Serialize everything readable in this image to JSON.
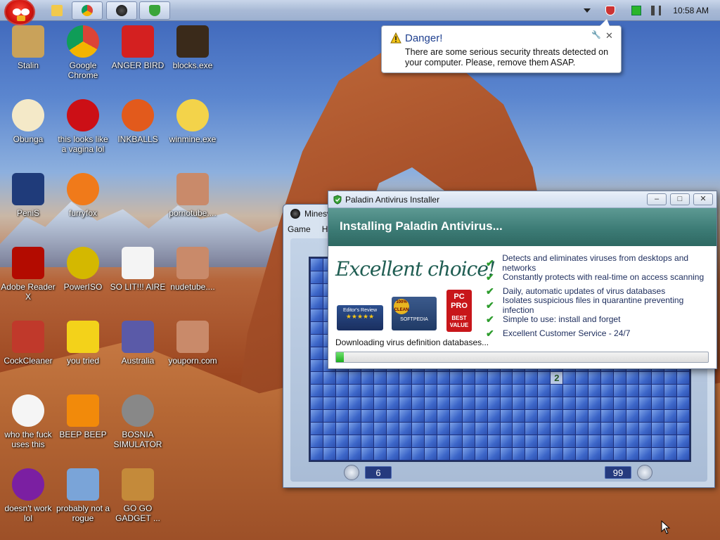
{
  "taskbar": {
    "clock": "10:58 AM",
    "buttons": [
      "folder-icon",
      "chrome-icon",
      "minesweeper-icon",
      "shield-icon"
    ]
  },
  "desktop": {
    "icons": [
      {
        "label": "Stalin",
        "icon": "user-folder-icon"
      },
      {
        "label": "Google Chrome",
        "icon": "chrome-icon"
      },
      {
        "label": "ANGER BIRD",
        "icon": "angry-bird-icon"
      },
      {
        "label": "blocks.exe",
        "icon": "blocks-icon"
      },
      {
        "label": "Obunga",
        "icon": "egg-icon"
      },
      {
        "label": "this looks like a vagina lol",
        "icon": "opera-icon"
      },
      {
        "label": "INKBALLS",
        "icon": "inkball-icon"
      },
      {
        "label": "winmine.exe",
        "icon": "flower-icon"
      },
      {
        "label": "PeniS",
        "icon": "photoshop-icon"
      },
      {
        "label": "furryfox",
        "icon": "firefox-icon"
      },
      {
        "label": "pornotube....",
        "icon": "thumbnail-icon"
      },
      {
        "label": "Adobe Reader X",
        "icon": "adobe-reader-icon"
      },
      {
        "label": "PowerISO",
        "icon": "disc-icon"
      },
      {
        "label": "SO LIT!!! AIRE",
        "icon": "solitaire-icon"
      },
      {
        "label": "nudetube....",
        "icon": "thumbnail-icon"
      },
      {
        "label": "CockCleaner",
        "icon": "ccleaner-icon"
      },
      {
        "label": "you tried",
        "icon": "star-icon"
      },
      {
        "label": "Australia",
        "icon": "chess-icon"
      },
      {
        "label": "youporn.com",
        "icon": "thumbnail-icon"
      },
      {
        "label": "who the fuck uses this",
        "icon": "winamp-icon"
      },
      {
        "label": "BEEP BEEP",
        "icon": "vlc-icon"
      },
      {
        "label": "BOSNIA SIMULATOR",
        "icon": "mine-icon"
      },
      {
        "label": "doesn't work lol",
        "icon": "yahoo-icon"
      },
      {
        "label": "probably not a rogue",
        "icon": "computer-gears-icon"
      },
      {
        "label": "GO GO GADGET ...",
        "icon": "briefcase-icon"
      }
    ]
  },
  "balloon": {
    "title": "Danger!",
    "message": "There are some serious security threats detected on your computer. Please, remove them ASAP."
  },
  "minesweeper": {
    "title": "Minesw",
    "menu": [
      "Game",
      "H"
    ],
    "revealed_number": "2",
    "time": "6",
    "mines": "99"
  },
  "installer": {
    "title": "Paladin Antivirus Installer",
    "heading": "Installing Paladin Antivirus...",
    "tagline": "Excellent choice!",
    "badges": {
      "review": "Editor's Review",
      "clean": "100% CLEAN",
      "softpedia": "SOFTPEDIA",
      "pcpro": "PC PRO",
      "best": "BEST VALUE"
    },
    "features": [
      "Detects and eliminates viruses from desktops and networks",
      "Constantly protects with real-time on access scanning",
      "Daily, automatic updates of virus databases",
      "Isolates suspicious files in quarantine preventing infection",
      "Simple to use: install and forget",
      "Excellent Customer Service - 24/7"
    ],
    "status": "Downloading virus definition databases...",
    "progress_percent": 2
  },
  "colors": {
    "accent_teal": "#3d7c76",
    "progress_green": "#1fae1f",
    "mine_blue": "#3d67c9"
  }
}
